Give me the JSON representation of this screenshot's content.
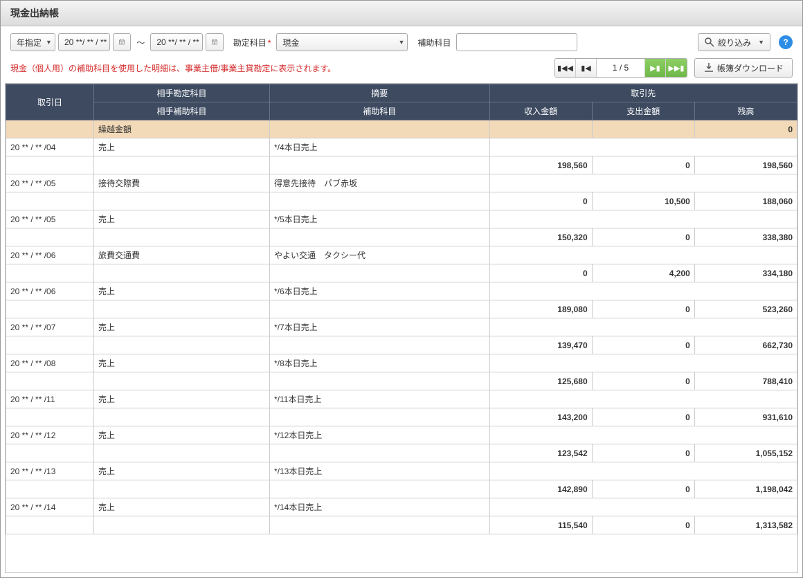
{
  "title": "現金出納帳",
  "toolbar": {
    "year_mode": "年指定",
    "date_from": "20 **/ ** / **",
    "date_to": "20 **/ ** / **",
    "tilde": "～",
    "account_label": "勘定科目",
    "account_value": "現金",
    "sub_label": "補助科目",
    "filter_label": "絞り込み",
    "help": "?"
  },
  "warning": "現金（個人用）の補助科目を使用した明細は、事業主借/事業主貸勘定に表示されます。",
  "pager": {
    "page": "1",
    "sep": "/",
    "total": "5"
  },
  "download": "帳簿ダウンロード",
  "headers": {
    "date": "取引日",
    "acct": "相手勘定科目",
    "desc": "摘要",
    "party": "取引先",
    "subacct": "相手補助科目",
    "subdesc": "補助科目",
    "income": "収入金額",
    "expense": "支出金額",
    "balance": "残高"
  },
  "carry": {
    "label": "繰越金額",
    "balance": "0"
  },
  "rows": [
    {
      "date": "20 ** / ** /04",
      "acct": "売上",
      "desc": "*/4本日売上",
      "income": "198,560",
      "expense": "0",
      "balance": "198,560"
    },
    {
      "date": "20 ** / ** /05",
      "acct": "接待交際費",
      "desc": "得意先接待　パブ赤坂",
      "income": "0",
      "expense": "10,500",
      "balance": "188,060"
    },
    {
      "date": "20 ** / ** /05",
      "acct": "売上",
      "desc": "*/5本日売上",
      "income": "150,320",
      "expense": "0",
      "balance": "338,380"
    },
    {
      "date": "20 ** / ** /06",
      "acct": "旅費交通費",
      "desc": "やよい交通　タクシー代",
      "income": "0",
      "expense": "4,200",
      "balance": "334,180"
    },
    {
      "date": "20 ** / ** /06",
      "acct": "売上",
      "desc": "*/6本日売上",
      "income": "189,080",
      "expense": "0",
      "balance": "523,260"
    },
    {
      "date": "20 ** / ** /07",
      "acct": "売上",
      "desc": "*/7本日売上",
      "income": "139,470",
      "expense": "0",
      "balance": "662,730"
    },
    {
      "date": "20 ** / ** /08",
      "acct": "売上",
      "desc": "*/8本日売上",
      "income": "125,680",
      "expense": "0",
      "balance": "788,410"
    },
    {
      "date": "20 ** / ** /11",
      "acct": "売上",
      "desc": "*/11本日売上",
      "income": "143,200",
      "expense": "0",
      "balance": "931,610"
    },
    {
      "date": "20 ** / ** /12",
      "acct": "売上",
      "desc": "*/12本日売上",
      "income": "123,542",
      "expense": "0",
      "balance": "1,055,152"
    },
    {
      "date": "20 ** / ** /13",
      "acct": "売上",
      "desc": "*/13本日売上",
      "income": "142,890",
      "expense": "0",
      "balance": "1,198,042"
    },
    {
      "date": "20 ** / ** /14",
      "acct": "売上",
      "desc": "*/14本日売上",
      "income": "115,540",
      "expense": "0",
      "balance": "1,313,582"
    }
  ]
}
